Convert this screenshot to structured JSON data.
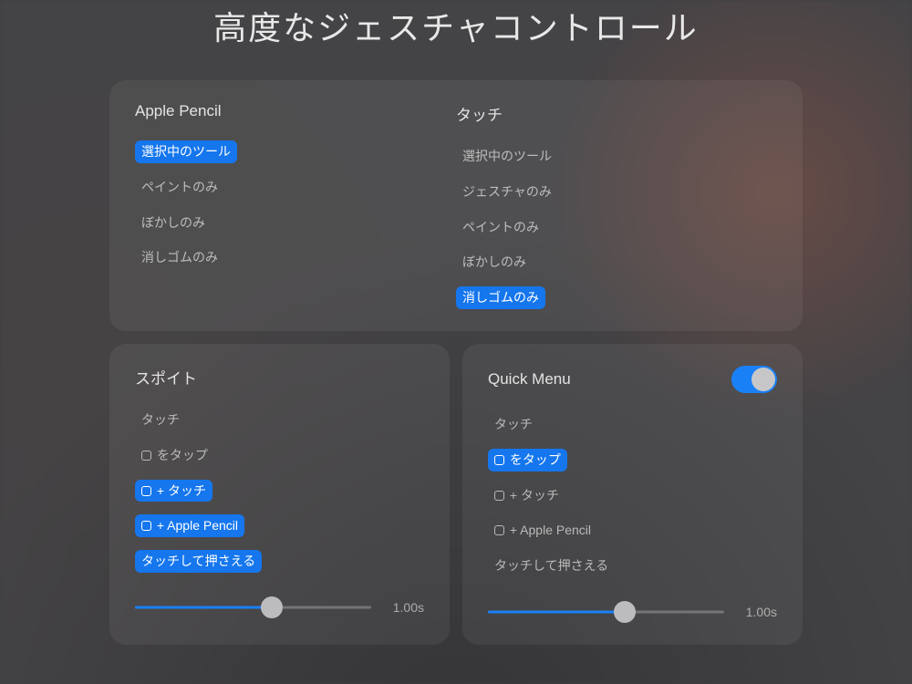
{
  "title": "高度なジェスチャコントロール",
  "topPanel": {
    "pencil": {
      "header": "Apple Pencil",
      "options": [
        {
          "label": "選択中のツール",
          "selected": true
        },
        {
          "label": "ペイントのみ",
          "selected": false
        },
        {
          "label": "ぼかしのみ",
          "selected": false
        },
        {
          "label": "消しゴムのみ",
          "selected": false
        }
      ]
    },
    "touch": {
      "header": "タッチ",
      "options": [
        {
          "label": "選択中のツール",
          "selected": false
        },
        {
          "label": "ジェスチャのみ",
          "selected": false
        },
        {
          "label": "ペイントのみ",
          "selected": false
        },
        {
          "label": "ぼかしのみ",
          "selected": false
        },
        {
          "label": "消しゴムのみ",
          "selected": true
        }
      ]
    }
  },
  "eyedropper": {
    "header": "スポイト",
    "options": [
      {
        "label": "タッチ",
        "selected": false,
        "icon": false
      },
      {
        "label": "をタップ",
        "selected": false,
        "icon": true
      },
      {
        "label": "+ タッチ",
        "selected": true,
        "icon": true
      },
      {
        "label": "+ Apple Pencil",
        "selected": true,
        "icon": true
      },
      {
        "label": "タッチして押さえる",
        "selected": true,
        "icon": false
      }
    ],
    "sliderValue": "1.00s"
  },
  "quickMenu": {
    "header": "Quick Menu",
    "toggle": true,
    "options": [
      {
        "label": "タッチ",
        "selected": false,
        "icon": false
      },
      {
        "label": "をタップ",
        "selected": true,
        "icon": true
      },
      {
        "label": "+ タッチ",
        "selected": false,
        "icon": true
      },
      {
        "label": "+ Apple Pencil",
        "selected": false,
        "icon": true
      },
      {
        "label": "タッチして押さえる",
        "selected": false,
        "icon": false
      }
    ],
    "sliderValue": "1.00s"
  }
}
